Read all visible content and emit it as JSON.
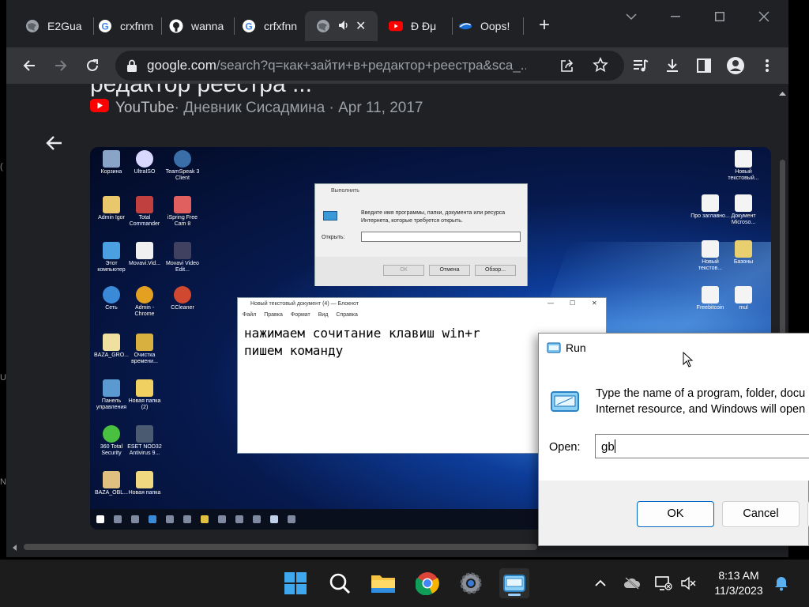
{
  "browser": {
    "tabs": [
      {
        "label": "E2Gua",
        "icon": "globe-icon"
      },
      {
        "label": "crxfnm",
        "icon": "google-icon"
      },
      {
        "label": "wanna",
        "icon": "github-icon"
      },
      {
        "label": "crfxfnn",
        "icon": "google-icon"
      },
      {
        "label": "",
        "icon": "globe-icon",
        "active": true,
        "audio": true
      },
      {
        "label": "Đ Đμ",
        "icon": "youtube-icon"
      },
      {
        "label": "Oops!",
        "icon": "app-icon"
      }
    ],
    "url_host": "google.com",
    "url_path": "/search?q=как+зайти+в+редактор+реестра&sca_..."
  },
  "result": {
    "title": "редактор реестра ...",
    "source_site": "YouTube",
    "source_meta": " · Дневник Сисадмина · Apr 11, 2017"
  },
  "embedded": {
    "run_title": "Выполнить",
    "run_desc": "Введите имя программы, папки, документа или ресурса Интернета, которые требуется открыть.",
    "run_open": "Открыть:",
    "run_ok": "ОК",
    "run_cancel": "Отмена",
    "run_browse": "Обзор...",
    "notepad_title": "Новый текстовый документ (4) — Блокнот",
    "notepad_menu": [
      "Файл",
      "Правка",
      "Формат",
      "Вид",
      "Справка"
    ],
    "notepad_line1": "нажимаем сочитание клавиш win+r",
    "notepad_line2": "пишем команду",
    "icons": [
      "Корзина",
      "UltraISO",
      "TeamSpeak 3 Client",
      "Admin Igor",
      "Total Commander",
      "iSpring Free Cam 8",
      "Этот компьютер",
      "Movavi.Vid...",
      "Movavi Video Edit...",
      "Сеть",
      "Admin - Chrome",
      "CCleaner",
      "BAZA_GRO...",
      "Очистка времени...",
      "Панель управления",
      "Новая папка (2)",
      "360 Total Security",
      "ESET NOD32 Antivirus 9...",
      "BAZA_OBL...",
      "Новая папка",
      "Новый текстовый...",
      "Про заглавно...",
      "Документ Microso...",
      "Новый текстов...",
      "Базоны",
      "Freebitcoin",
      "mul"
    ]
  },
  "run_dialog": {
    "title": "Run",
    "description_line1": "Type the name of a program, folder, docu",
    "description_line2": "Internet resource, and Windows will open",
    "open_label": "Open:",
    "open_value": "gb",
    "ok_label": "OK",
    "cancel_label": "Cancel"
  },
  "taskbar": {
    "apps": [
      "windows-start-icon",
      "search-icon",
      "file-explorer-icon",
      "chrome-icon",
      "settings-icon",
      "run-icon"
    ],
    "time": "8:13 AM",
    "date": "11/3/2023"
  },
  "colors": {
    "chrome_bg": "#202124",
    "toolbar_bg": "#35363a",
    "accent": "#0067c0",
    "taskbar_bg": "#1c1c1c"
  }
}
